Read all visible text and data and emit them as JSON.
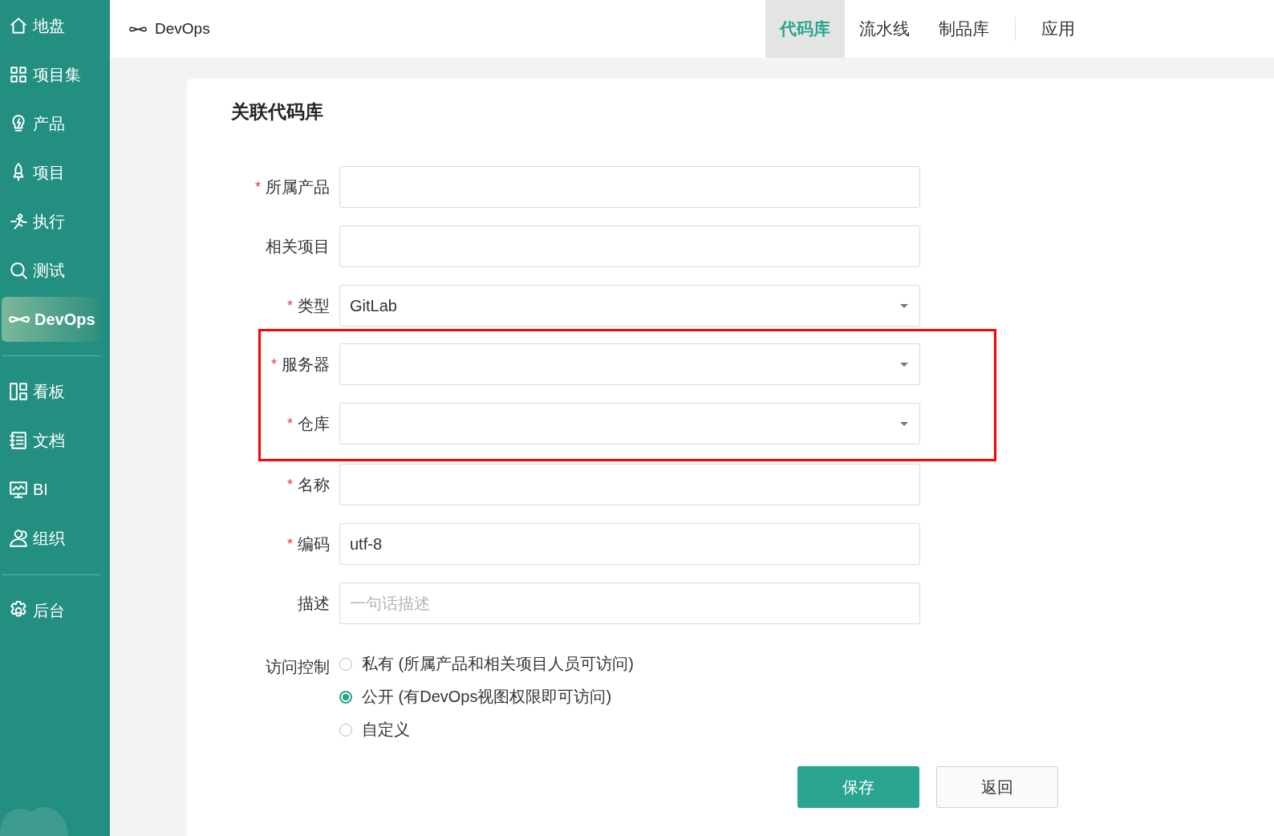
{
  "sidebar": {
    "groups": [
      {
        "items": [
          {
            "label": "地盘",
            "selected": false
          },
          {
            "label": "项目集",
            "selected": false
          },
          {
            "label": "产品",
            "selected": false
          },
          {
            "label": "项目",
            "selected": false
          },
          {
            "label": "执行",
            "selected": false
          },
          {
            "label": "测试",
            "selected": false
          },
          {
            "label": "DevOps",
            "selected": true
          }
        ]
      },
      {
        "items": [
          {
            "label": "看板",
            "selected": false
          },
          {
            "label": "文档",
            "selected": false
          },
          {
            "label": "BI",
            "selected": false
          },
          {
            "label": "组织",
            "selected": false
          }
        ]
      },
      {
        "items": [
          {
            "label": "后台",
            "selected": false
          }
        ]
      }
    ]
  },
  "header": {
    "module": "DevOps",
    "tabs": [
      {
        "label": "代码库",
        "selected": true
      },
      {
        "label": "流水线",
        "selected": false
      },
      {
        "label": "制品库",
        "selected": false
      },
      {
        "label": "应用",
        "selected": false
      }
    ]
  },
  "form": {
    "title": "关联代码库",
    "field_groups": [
      {
        "kind": "plain",
        "fields": [
          {
            "kind": "input",
            "label": "所属产品",
            "required_mark": "*"
          },
          {
            "kind": "input",
            "label": "相关项目"
          },
          {
            "kind": "select",
            "label": "类型",
            "required_mark": "*",
            "value": "GitLab"
          }
        ]
      },
      {
        "kind": "annotated",
        "fields": [
          {
            "kind": "select",
            "label": "服务器",
            "required_mark": "*"
          },
          {
            "kind": "select",
            "label": "仓库",
            "required_mark": "*"
          }
        ]
      },
      {
        "kind": "plain",
        "fields": [
          {
            "kind": "input",
            "label": "名称",
            "required_mark": "*"
          },
          {
            "kind": "input",
            "label": "编码",
            "required_mark": "*",
            "value": "utf-8"
          },
          {
            "kind": "input",
            "label": "描述",
            "placeholder": "一句话描述"
          }
        ]
      }
    ],
    "access": {
      "label": "访问控制",
      "options": [
        {
          "label": "私有 (所属产品和相关项目人员可访问)",
          "selected": false
        },
        {
          "label": "公开 (有DevOps视图权限即可访问)",
          "selected": true
        },
        {
          "label": "自定义",
          "selected": false
        }
      ]
    },
    "buttons": [
      {
        "kind": "primary",
        "label": "保存"
      },
      {
        "kind": "secondary",
        "label": "返回"
      }
    ]
  }
}
